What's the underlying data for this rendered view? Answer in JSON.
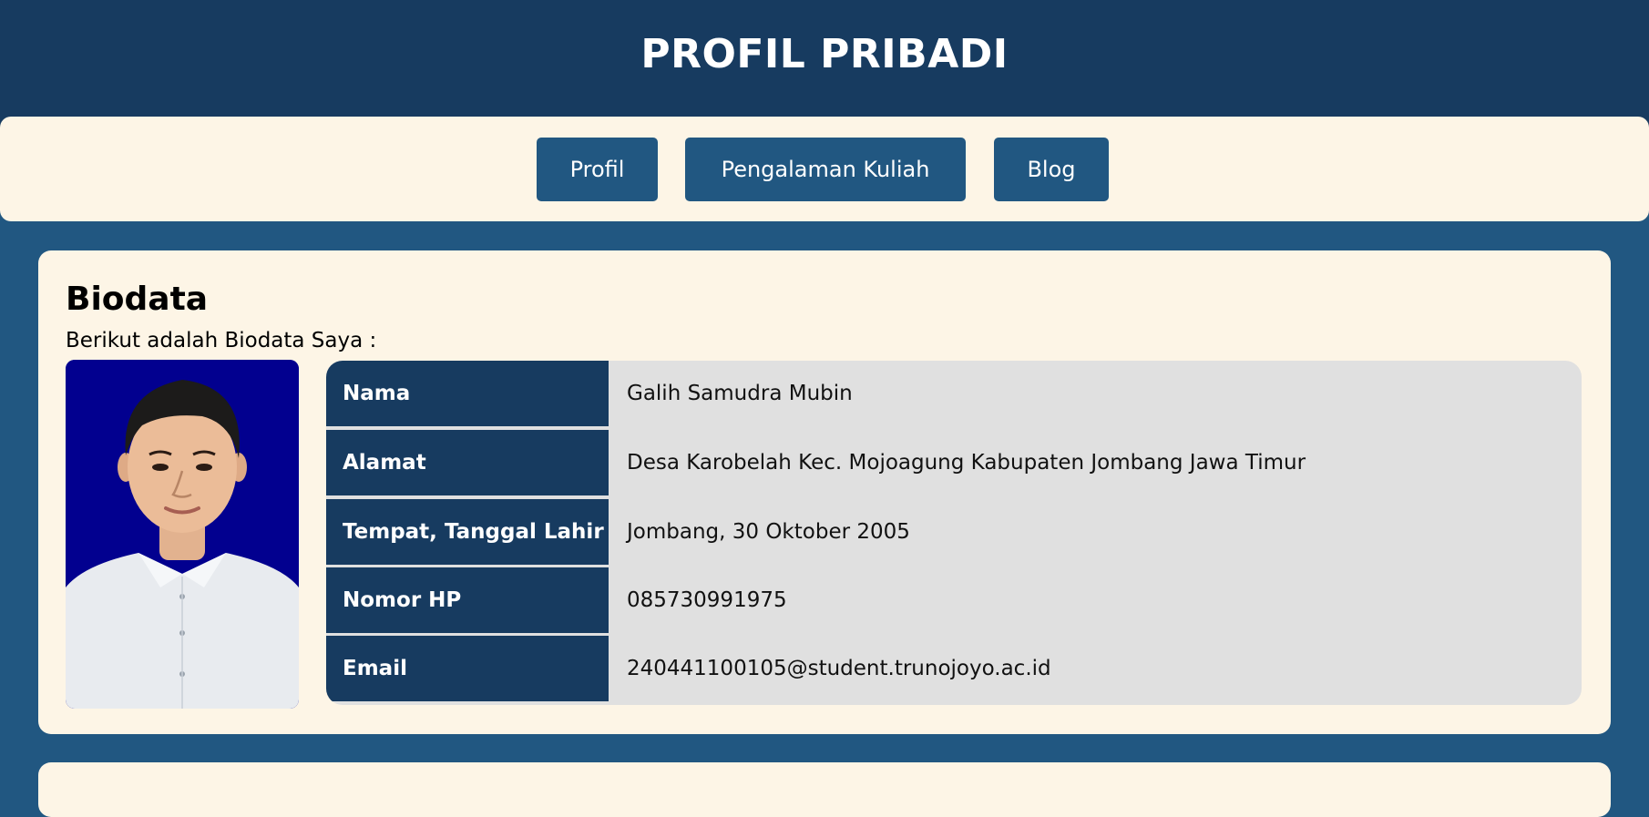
{
  "header": {
    "title": "PROFIL PRIBADI"
  },
  "nav": {
    "items": [
      {
        "label": "Profil"
      },
      {
        "label": "Pengalaman Kuliah"
      },
      {
        "label": "Blog"
      }
    ]
  },
  "biodata": {
    "title": "Biodata",
    "subtitle": "Berikut adalah Biodata Saya :",
    "rows": [
      {
        "label": "Nama",
        "value": "Galih Samudra Mubin"
      },
      {
        "label": "Alamat",
        "value": "Desa Karobelah Kec. Mojoagung Kabupaten Jombang Jawa Timur"
      },
      {
        "label": "Tempat, Tanggal Lahir",
        "value": "Jombang, 30 Oktober 2005"
      },
      {
        "label": "Nomor HP",
        "value": "085730991975"
      },
      {
        "label": "Email",
        "value": "240441100105@student.trunojoyo.ac.id"
      }
    ]
  },
  "colors": {
    "header_bg": "#173b60",
    "page_bg": "#215781",
    "card_bg": "#fdf5e6",
    "table_bg": "#e0e0e0",
    "photo_bg": "#02008f"
  }
}
